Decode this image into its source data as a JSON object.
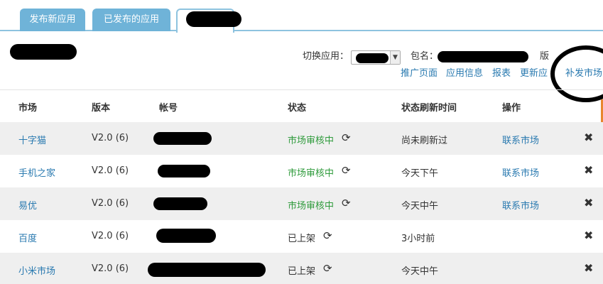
{
  "tabs": [
    {
      "label": "发布新应用"
    },
    {
      "label": "已发布的应用"
    },
    {
      "label": ""
    }
  ],
  "toolbar": {
    "switch_app_label": "切换应用：",
    "package_label": "包名：",
    "version_label": "版"
  },
  "links": {
    "promo_page": "推广页面",
    "app_info": "应用信息",
    "report": "报表",
    "update_app": "更新应",
    "reissue": "补发市场"
  },
  "table": {
    "headers": [
      "市场",
      "版本",
      "帐号",
      "状态",
      "状态刷新时间",
      "操作"
    ],
    "rows": [
      {
        "market": "十字猫",
        "version": "V2.0 (6)",
        "status": "市场审核中",
        "status_color": "#2f9b3c",
        "refresh_time": "尚未刷新过",
        "action": "联系市场"
      },
      {
        "market": "手机之家",
        "version": "V2.0 (6)",
        "status": "市场审核中",
        "status_color": "#2f9b3c",
        "refresh_time": "今天下午",
        "action": "联系市场"
      },
      {
        "market": "易优",
        "version": "V2.0 (6)",
        "status": "市场审核中",
        "status_color": "#2f9b3c",
        "refresh_time": "今天中午",
        "action": "联系市场"
      },
      {
        "market": "百度",
        "version": "V2.0 (6)",
        "status": "已上架",
        "status_color": "#333333",
        "refresh_time": "3小时前",
        "action": ""
      },
      {
        "market": "小米市场",
        "version": "V2.0 (6)",
        "status": "已上架",
        "status_color": "#333333",
        "refresh_time": "今天中午",
        "action": ""
      }
    ]
  },
  "icons": {
    "refresh": "refresh-icon",
    "delete": "close-icon",
    "dropdown": "chevron-down-icon"
  },
  "colors": {
    "tab_bg": "#6fb3d8",
    "link": "#2a7ab0",
    "status_reviewing": "#2f9b3c",
    "row_stripe": "#efefef"
  }
}
